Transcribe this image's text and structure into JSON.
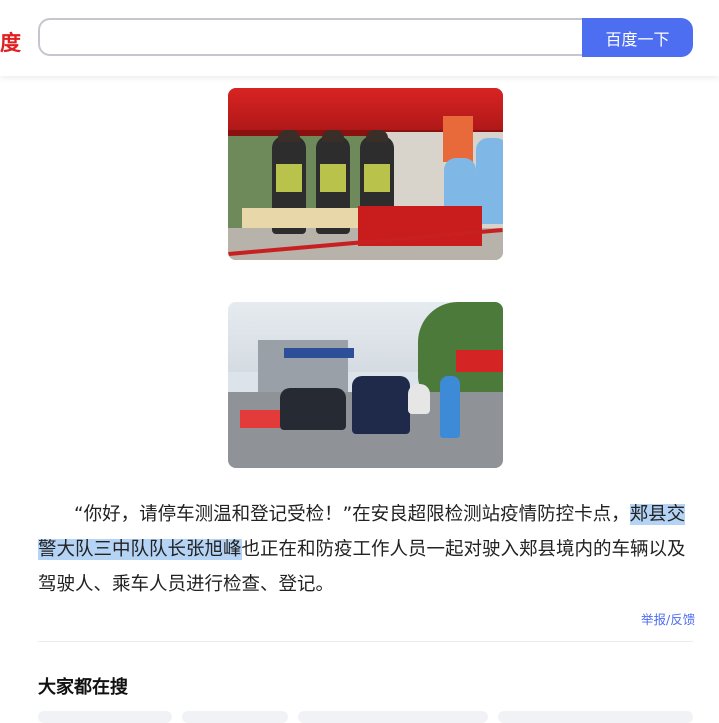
{
  "header": {
    "logo_fragment": "度",
    "search_value": "",
    "search_button": "百度一下"
  },
  "images": [
    {
      "name": "checkpoint-tent-photo",
      "icon": "photo"
    },
    {
      "name": "road-checkpoint-photo",
      "icon": "photo"
    }
  ],
  "article": {
    "text_before": "“你好，请停车测温和登记受检！”在安良超限检测站疫情防控卡点，",
    "highlighted": "郏县交警大队三中队队长张旭峰",
    "text_after": "也正在和防疫工作人员一起对驶入郏县境内的车辆以及驾驶人、乘车人员进行检查、登记。"
  },
  "report_link": "举报/反馈",
  "related_search": {
    "title": "大家都在搜"
  },
  "colors": {
    "brand_blue": "#4e6ef2",
    "logo_red": "#e02020",
    "highlight": "#b4d3f5"
  }
}
